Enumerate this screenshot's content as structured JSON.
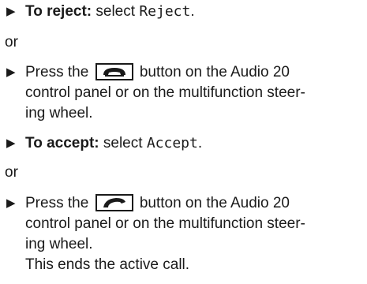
{
  "steps": [
    {
      "lead": "To reject:",
      "text": "select",
      "ui_text": "Reject",
      "tail": "."
    },
    {
      "text_before": "Press the",
      "icon": "end-call-icon",
      "text_after": "button on the Audio 20",
      "line2": "control panel or on the multifunction steer-",
      "line3": "ing wheel."
    },
    {
      "lead": "To accept:",
      "text": "select",
      "ui_text": "Accept",
      "tail": "."
    },
    {
      "text_before": "Press the",
      "icon": "accept-call-icon",
      "text_after": "button on the Audio 20",
      "line2": "control panel or on the multifunction steer-",
      "line3": "ing wheel.",
      "result": "This ends the active call."
    }
  ],
  "separators": [
    "or",
    "or"
  ],
  "bullet_glyph": "▶"
}
